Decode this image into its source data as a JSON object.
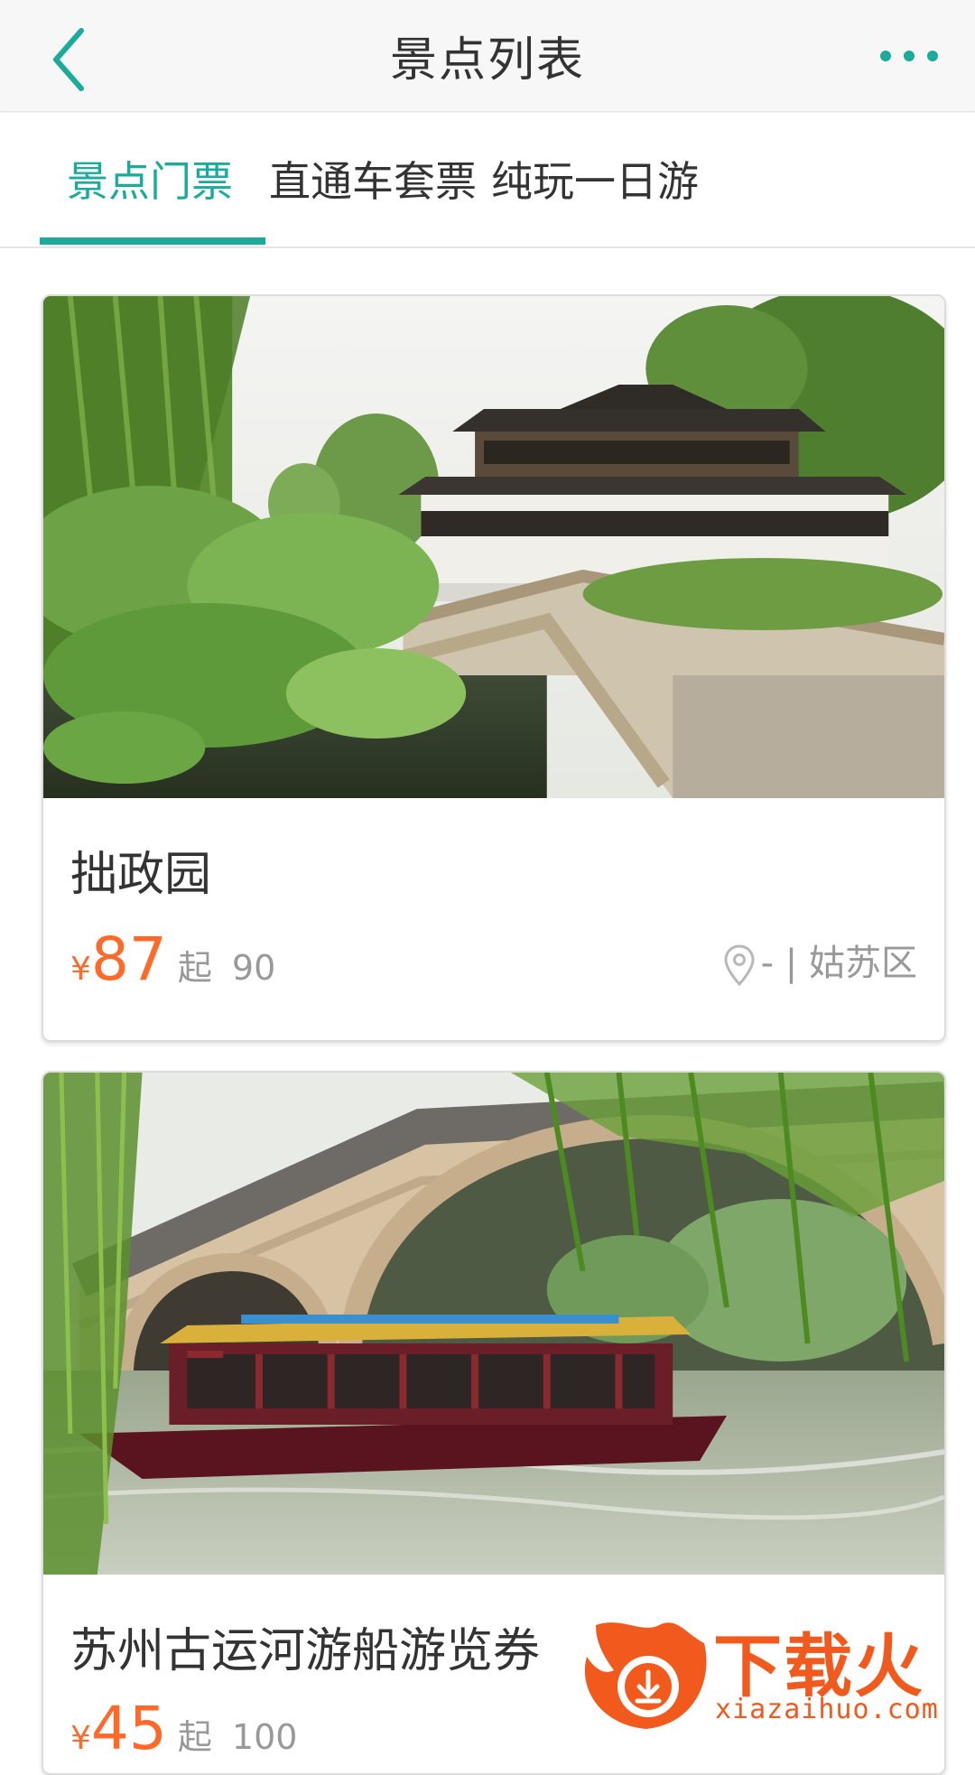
{
  "header": {
    "title": "景点列表",
    "back_icon": "chevron-left-icon",
    "more_icon": "more-dots-icon"
  },
  "tabs": [
    {
      "label": "景点门票",
      "active": true
    },
    {
      "label": "直通车套票",
      "active": false
    },
    {
      "label": "纯玩一日游",
      "active": false
    }
  ],
  "cards": [
    {
      "image": "classical-garden-pavilion-photo",
      "title": "拙政园",
      "currency": "¥",
      "price": "87",
      "from_label": "起",
      "original_price": "90",
      "location": "- | 姑苏区"
    },
    {
      "image": "canal-boat-stone-bridge-photo",
      "title": "苏州古运河游船游览券",
      "currency": "¥",
      "price": "45",
      "from_label": "起",
      "original_price": "100"
    }
  ],
  "watermark": {
    "text": "下载火",
    "url": "xiazaihuo.com"
  },
  "colors": {
    "accent": "#1aab9b",
    "price": "#ff6a2a",
    "muted": "#999999"
  }
}
